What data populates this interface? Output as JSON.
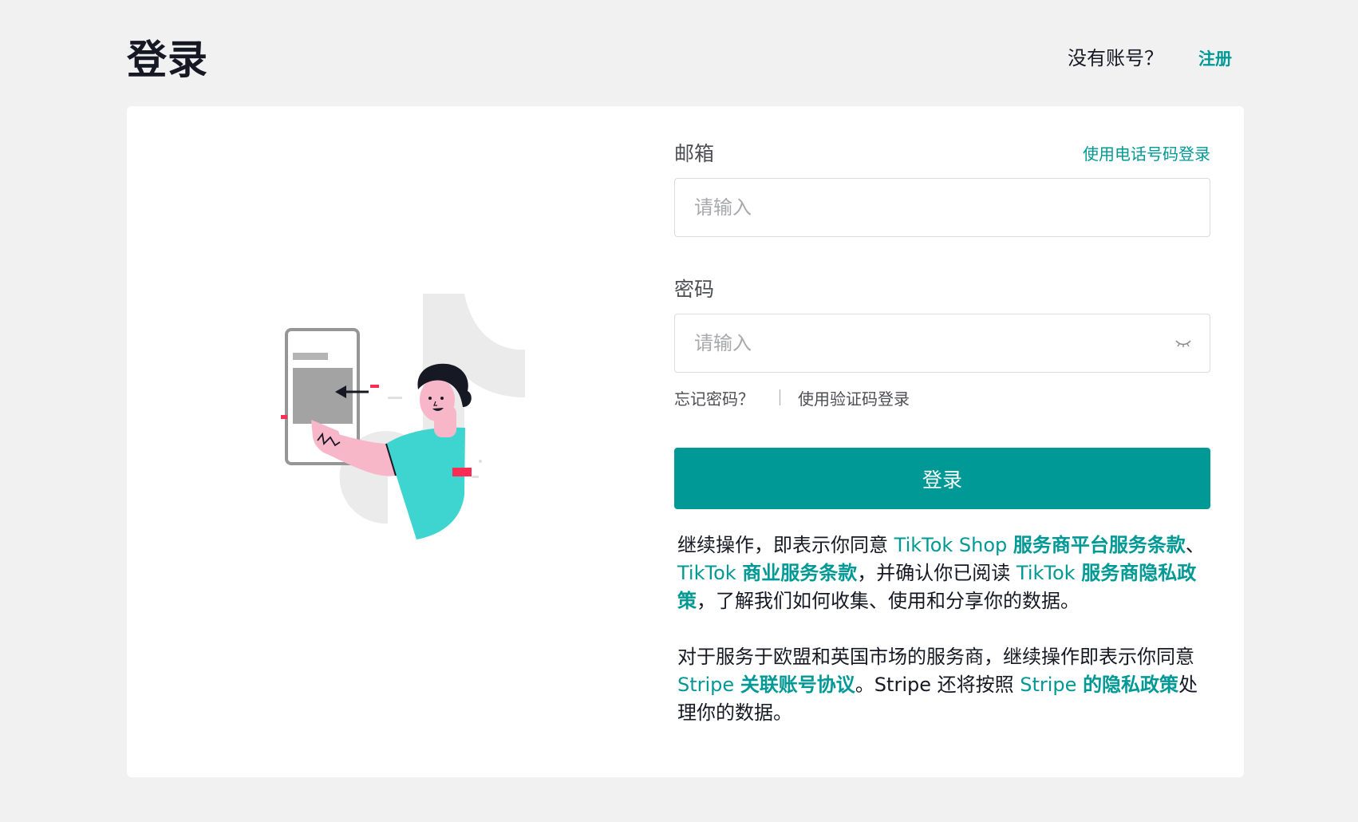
{
  "header": {
    "title": "登录",
    "signup_prompt": "没有账号？",
    "signup_link": "注册"
  },
  "form": {
    "email_label": "邮箱",
    "phone_login_link": "使用电话号码登录",
    "email_placeholder": "请输入",
    "password_label": "密码",
    "password_placeholder": "请输入",
    "forgot_password": "忘记密码？",
    "code_login_link": "使用验证码登录",
    "submit_label": "登录"
  },
  "terms": {
    "p1_a": "继续操作，即表示你同意 ",
    "p1_brand1": "TikTok Shop ",
    "p1_link1": "服务商平台服务条款",
    "p1_b": "、",
    "p1_brand2": "TikTok ",
    "p1_link2": "商业服务条款",
    "p1_c": "，并确认你已阅读 ",
    "p1_brand3": "TikTok ",
    "p1_link3": "服务商隐私政策",
    "p1_d": "，了解我们如何收集、使用和分享你的数据。",
    "p2_a": "对于服务于欧盟和英国市场的服务商，继续操作即表示你同意 ",
    "p2_brand1": "Stripe ",
    "p2_link1": "关联账号协议",
    "p2_b": "。Stripe 还将按照 ",
    "p2_brand2": "Stripe ",
    "p2_link2": "的隐私政策",
    "p2_c": "处理你的数据。"
  },
  "icons": {
    "password_toggle": "eye-closed-icon"
  },
  "colors": {
    "accent": "#009995",
    "background": "#f1f1f2",
    "card": "#ffffff",
    "illustration_cyan": "#3ed4cf",
    "illustration_pink": "#f8b7c9",
    "illustration_red": "#fe2c55"
  }
}
